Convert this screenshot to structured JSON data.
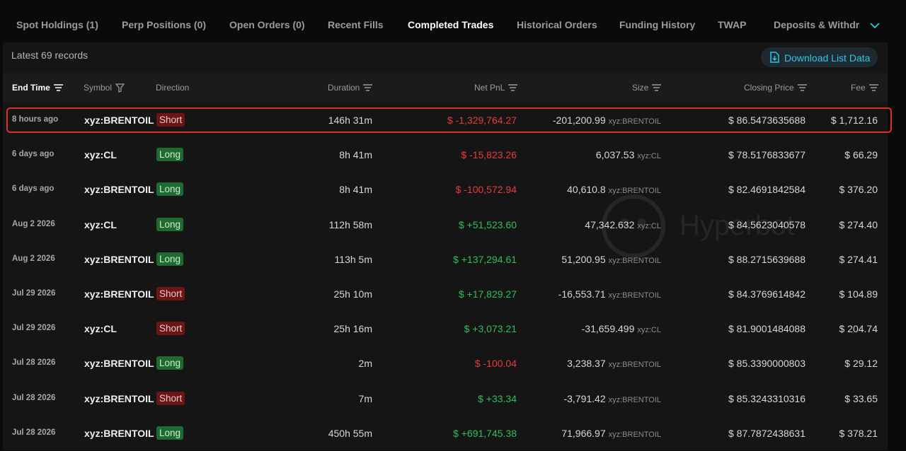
{
  "tabs": [
    {
      "label": "Spot Holdings (1)",
      "active": false
    },
    {
      "label": "Perp Positions (0)",
      "active": false
    },
    {
      "label": "Open Orders (0)",
      "active": false
    },
    {
      "label": "Recent Fills",
      "active": false
    },
    {
      "label": "Completed Trades",
      "active": true
    },
    {
      "label": "Historical Orders",
      "active": false
    },
    {
      "label": "Funding History",
      "active": false
    },
    {
      "label": "TWAP",
      "active": false
    },
    {
      "label": "Deposits & Withdraw",
      "active": false
    }
  ],
  "records_label": "Latest 69 records",
  "download_label": "Download List Data",
  "watermark": "Hyperbot",
  "columns": {
    "end_time": "End Time",
    "symbol": "Symbol",
    "direction": "Direction",
    "duration": "Duration",
    "net_pnl": "Net PnL",
    "size": "Size",
    "closing_price": "Closing Price",
    "fee": "Fee"
  },
  "rows": [
    {
      "time": "8 hours ago",
      "symbol": "xyz:BRENTOIL",
      "direction": "Short",
      "duration": "146h 31m",
      "pnl": "$ -1,329,764.27",
      "pnl_sign": "neg",
      "size": "-201,200.99",
      "size_unit": "xyz:BRENTOIL",
      "closing_price": "$ 86.5473635688",
      "fee": "$ 1,712.16"
    },
    {
      "time": "6 days ago",
      "symbol": "xyz:CL",
      "direction": "Long",
      "duration": "8h 41m",
      "pnl": "$ -15,823.26",
      "pnl_sign": "neg",
      "size": "6,037.53",
      "size_unit": "xyz:CL",
      "closing_price": "$ 78.5176833677",
      "fee": "$ 66.29"
    },
    {
      "time": "6 days ago",
      "symbol": "xyz:BRENTOIL",
      "direction": "Long",
      "duration": "8h 41m",
      "pnl": "$ -100,572.94",
      "pnl_sign": "neg",
      "size": "40,610.8",
      "size_unit": "xyz:BRENTOIL",
      "closing_price": "$ 82.4691842584",
      "fee": "$ 376.20"
    },
    {
      "time": "Aug 2 2026",
      "symbol": "xyz:CL",
      "direction": "Long",
      "duration": "112h 58m",
      "pnl": "$ +51,523.60",
      "pnl_sign": "pos",
      "size": "47,342.632",
      "size_unit": "xyz:CL",
      "closing_price": "$ 84.5623040578",
      "fee": "$ 274.40"
    },
    {
      "time": "Aug 2 2026",
      "symbol": "xyz:BRENTOIL",
      "direction": "Long",
      "duration": "113h 5m",
      "pnl": "$ +137,294.61",
      "pnl_sign": "pos",
      "size": "51,200.95",
      "size_unit": "xyz:BRENTOIL",
      "closing_price": "$ 88.2715639688",
      "fee": "$ 274.41"
    },
    {
      "time": "Jul 29 2026",
      "symbol": "xyz:BRENTOIL",
      "direction": "Short",
      "duration": "25h 10m",
      "pnl": "$ +17,829.27",
      "pnl_sign": "pos",
      "size": "-16,553.71",
      "size_unit": "xyz:BRENTOIL",
      "closing_price": "$ 84.3769614842",
      "fee": "$ 104.89"
    },
    {
      "time": "Jul 29 2026",
      "symbol": "xyz:CL",
      "direction": "Short",
      "duration": "25h 16m",
      "pnl": "$ +3,073.21",
      "pnl_sign": "pos",
      "size": "-31,659.499",
      "size_unit": "xyz:CL",
      "closing_price": "$ 81.9001484088",
      "fee": "$ 204.74"
    },
    {
      "time": "Jul 28 2026",
      "symbol": "xyz:BRENTOIL",
      "direction": "Long",
      "duration": "2m",
      "pnl": "$ -100.04",
      "pnl_sign": "neg",
      "size": "3,238.37",
      "size_unit": "xyz:BRENTOIL",
      "closing_price": "$ 85.3390000803",
      "fee": "$ 29.12"
    },
    {
      "time": "Jul 28 2026",
      "symbol": "xyz:BRENTOIL",
      "direction": "Short",
      "duration": "7m",
      "pnl": "$ +33.34",
      "pnl_sign": "pos",
      "size": "-3,791.42",
      "size_unit": "xyz:BRENTOIL",
      "closing_price": "$ 85.3243310316",
      "fee": "$ 33.65"
    },
    {
      "time": "Jul 28 2026",
      "symbol": "xyz:BRENTOIL",
      "direction": "Long",
      "duration": "450h 55m",
      "pnl": "$ +691,745.38",
      "pnl_sign": "pos",
      "size": "71,966.97",
      "size_unit": "xyz:BRENTOIL",
      "closing_price": "$ 87.7872438631",
      "fee": "$ 378.21"
    }
  ]
}
